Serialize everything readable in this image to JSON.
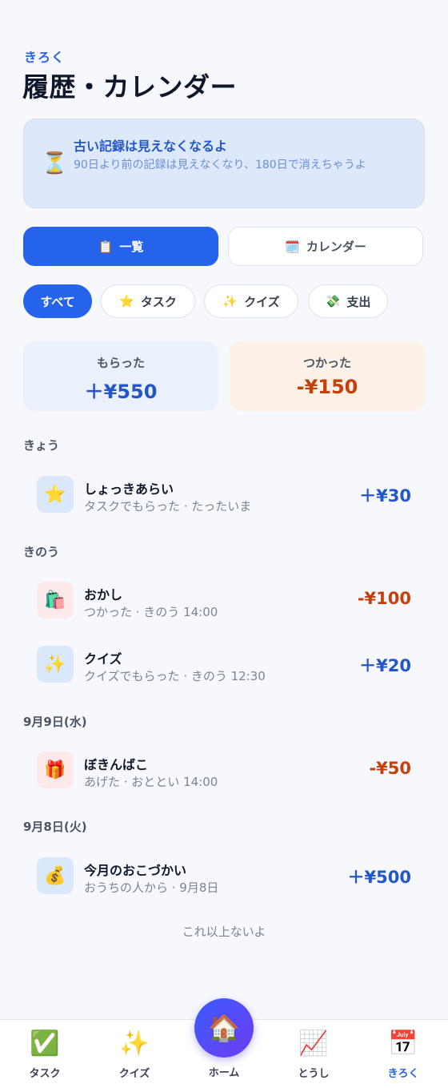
{
  "header": {
    "kicker": "きろく",
    "title": "履歴・カレンダー"
  },
  "notice": {
    "icon": "hourglass-icon",
    "icon_glyph": "⏳",
    "title": "古い記録は見えなくなるよ",
    "body": "90日より前の記録は見えなくなり、180日で消えちゃうよ"
  },
  "view_toggle": {
    "list": {
      "icon": "clipboard-icon",
      "icon_glyph": "📋",
      "label": "一覧",
      "active": true
    },
    "calendar": {
      "icon": "calendar-icon",
      "icon_glyph": "🗓️",
      "label": "カレンダー",
      "active": false
    }
  },
  "filters": [
    {
      "label": "すべて",
      "icon_glyph": "",
      "active": true
    },
    {
      "label": "タスク",
      "icon": "star-icon",
      "icon_glyph": "⭐",
      "active": false
    },
    {
      "label": "クイズ",
      "icon": "sparkles-icon",
      "icon_glyph": "✨",
      "active": false
    },
    {
      "label": "支出",
      "icon": "money-icon",
      "icon_glyph": "💸",
      "active": false
    }
  ],
  "summary": {
    "income": {
      "label": "もらった",
      "amount": "＋¥550"
    },
    "expense": {
      "label": "つかった",
      "amount": "-¥150"
    }
  },
  "groups": [
    {
      "label": "きょう",
      "entries": [
        {
          "icon": "star-icon",
          "icon_glyph": "⭐",
          "tone": "blue",
          "title": "しょっきあらい",
          "sub": "タスクでもらった · たったいま",
          "amount": "＋¥30",
          "sign": "plus"
        }
      ]
    },
    {
      "label": "きのう",
      "entries": [
        {
          "icon": "shopping-bag-icon",
          "icon_glyph": "🛍️",
          "tone": "red",
          "title": "おかし",
          "sub": "つかった · きのう 14:00",
          "amount": "-¥100",
          "sign": "minus"
        },
        {
          "icon": "sparkles-icon",
          "icon_glyph": "✨",
          "tone": "blue",
          "title": "クイズ",
          "sub": "クイズでもらった · きのう 12:30",
          "amount": "＋¥20",
          "sign": "plus"
        }
      ]
    },
    {
      "label": "9月9日(水)",
      "entries": [
        {
          "icon": "gift-icon",
          "icon_glyph": "🎁",
          "tone": "red",
          "title": "ぼきんばこ",
          "sub": "あげた · おととい 14:00",
          "amount": "-¥50",
          "sign": "minus"
        }
      ]
    },
    {
      "label": "9月8日(火)",
      "entries": [
        {
          "icon": "money-bag-icon",
          "icon_glyph": "💰",
          "tone": "blue",
          "title": "今月のおこづかい",
          "sub": "おうちの人から · 9月8日",
          "amount": "＋¥500",
          "sign": "plus"
        }
      ]
    }
  ],
  "end_note": "これ以上ないよ",
  "tabbar": {
    "tasks": {
      "icon": "check-icon",
      "icon_glyph": "✅",
      "label": "タスク"
    },
    "quiz": {
      "icon": "sparkles-icon",
      "icon_glyph": "✨",
      "label": "クイズ"
    },
    "home": {
      "icon": "house-icon",
      "icon_glyph": "🏠",
      "label": "ホーム"
    },
    "invest": {
      "icon": "chart-up-icon",
      "icon_glyph": "📈",
      "label": "とうし"
    },
    "records": {
      "icon": "calendar-icon",
      "icon_glyph": "📅",
      "label": "きろく",
      "active": true
    }
  }
}
